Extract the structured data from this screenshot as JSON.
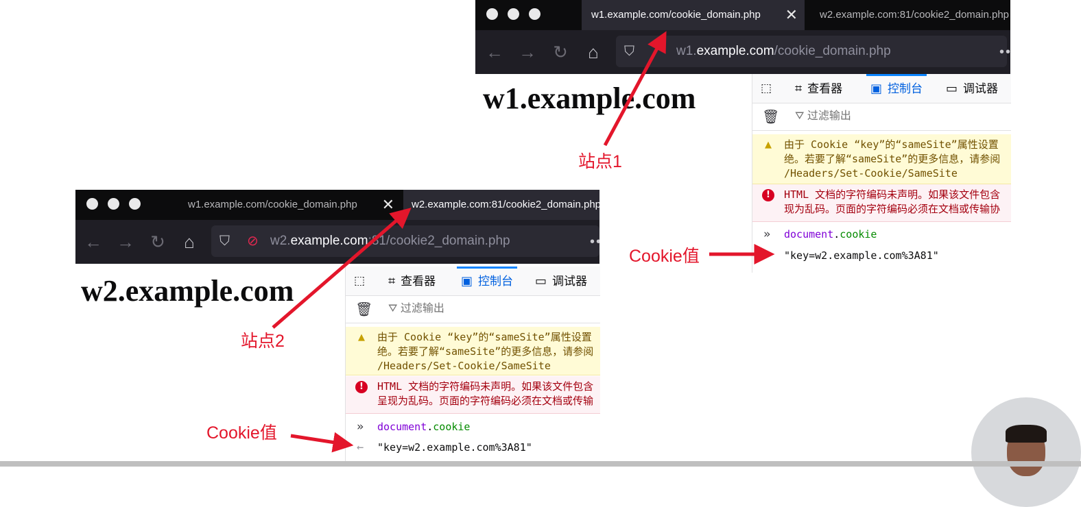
{
  "browser1": {
    "tab1_title": "w1.example.com/cookie_domain.php",
    "tab1_close": "✕",
    "tab2_title": "w2.example.com:81/cookie2_domain.php",
    "url_prefix": "w1.",
    "url_domain": "example.com",
    "url_path": "/cookie_domain.php",
    "page_heading": "w1.example.com"
  },
  "browser2": {
    "tab1_title": "w1.example.com/cookie_domain.php",
    "tab1_close": "✕",
    "tab2_title": "w2.example.com:81/cookie2_domain.php",
    "url_prefix": "w2.",
    "url_domain": "example.com",
    "url_path": ":81/cookie2_domain.php",
    "page_heading": "w2.example.com"
  },
  "devtools": {
    "tab_inspector": "查看器",
    "tab_console": "控制台",
    "tab_debugger": "调试器",
    "filter_placeholder": "过滤输出",
    "warning_text": "由于 Cookie “key”的“sameSite”属性设置\n绝。若要了解“sameSite”的更多信息，请参阅\n/Headers/Set-Cookie/SameSite",
    "error1_text": "HTML 文档的字符编码未声明。如果该文件包含\n现为乱码。页面的字符编码必须在文档或传输协",
    "error2_text": "HTML 文档的字符编码未声明。如果该文件包含\n呈现为乱码。页面的字符编码必须在文档或传输",
    "command_obj": "document",
    "command_dot": ".",
    "command_prop": "cookie",
    "result": "\"key=w2.example.com%3A81\""
  },
  "annotations": {
    "site1_label": "站点1",
    "site2_label": "站点2",
    "cookie_label": "Cookie值",
    "arrow_color": "#e3162b"
  },
  "icons": [
    "back-icon",
    "forward-icon",
    "reload-icon",
    "home-icon",
    "shield-icon",
    "picker-icon",
    "inspector-icon",
    "console-icon",
    "debugger-icon",
    "trash-icon",
    "filter-icon",
    "warning-icon",
    "error-icon",
    "prompt-icon",
    "result-arrow-icon"
  ]
}
